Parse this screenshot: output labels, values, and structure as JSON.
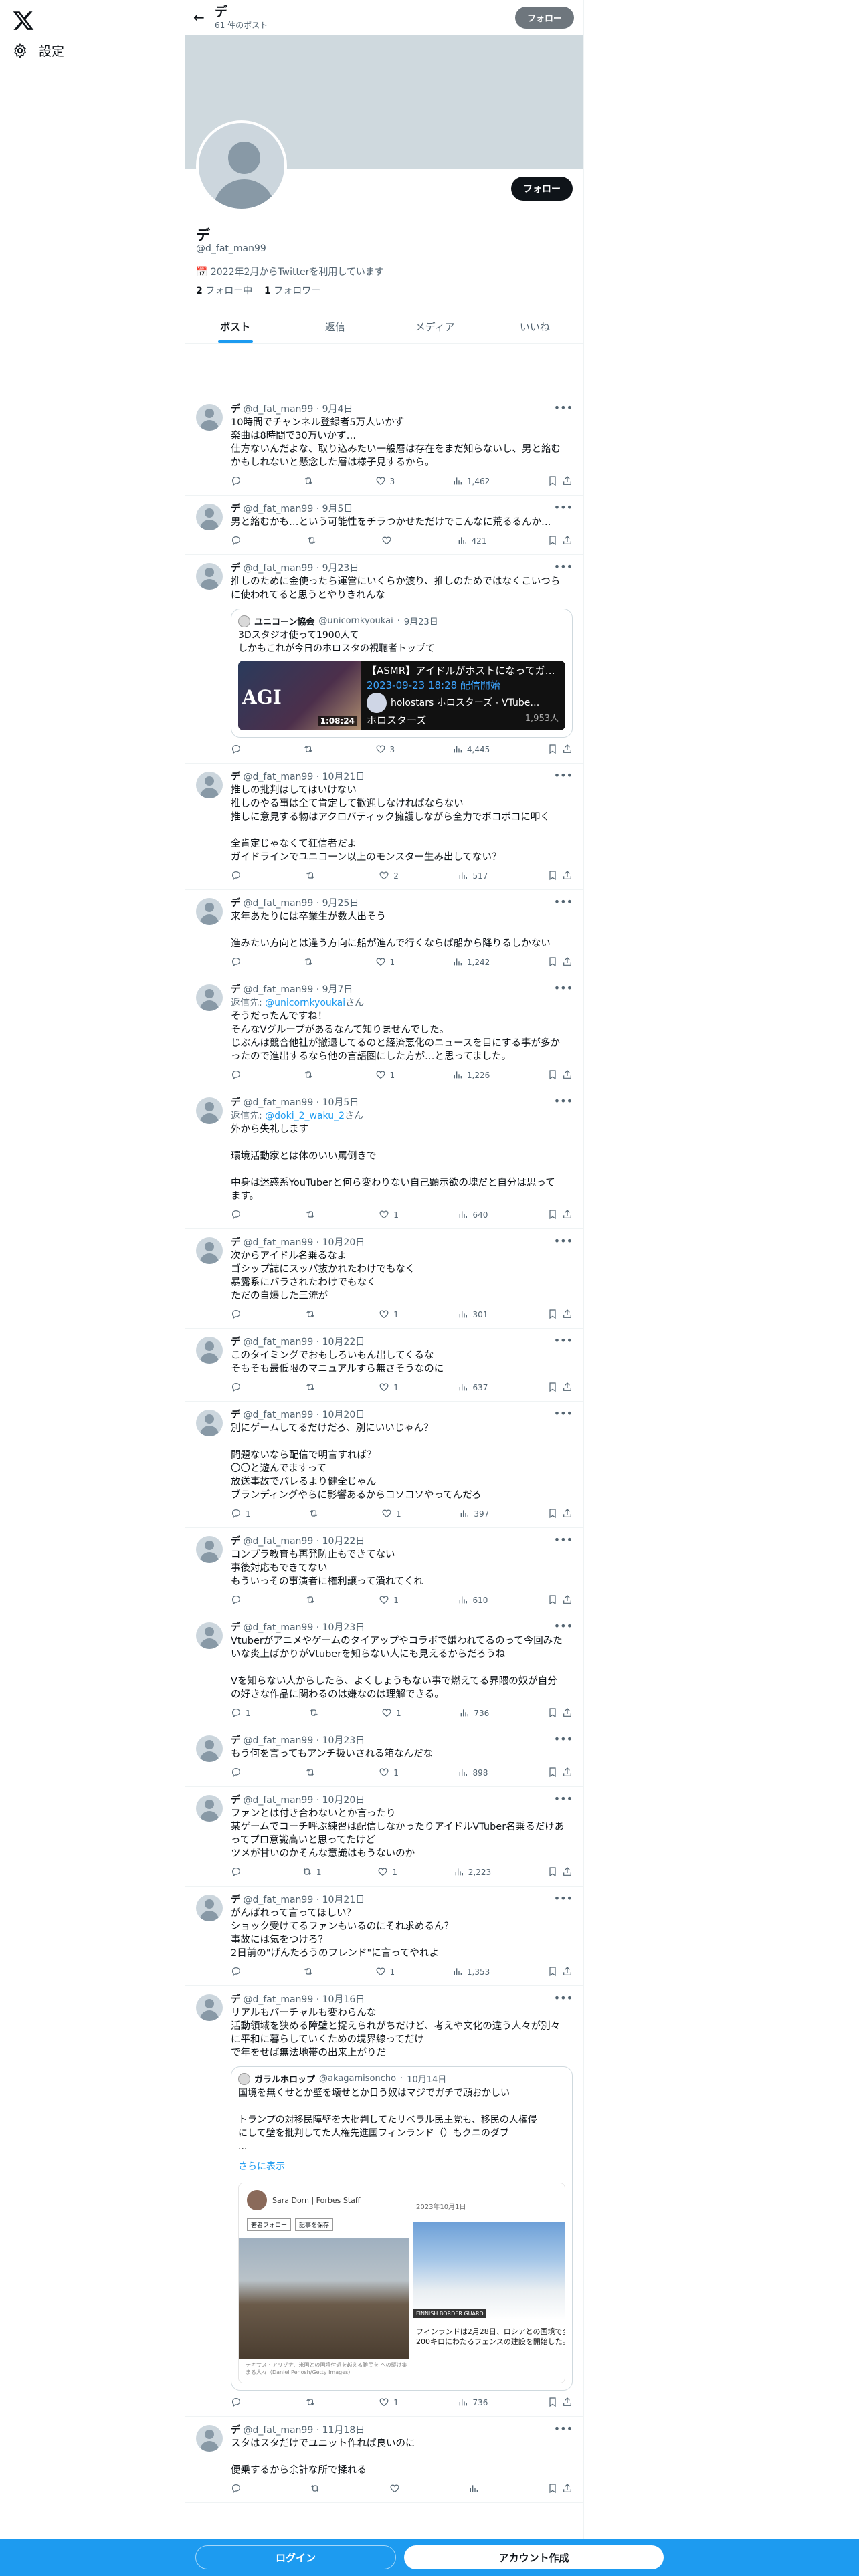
{
  "sidebar": {
    "settings_label": "設定"
  },
  "header": {
    "name": "デ",
    "post_count": "61 件のポスト",
    "follow_label": "フォロー"
  },
  "profile": {
    "name": "デ",
    "handle": "@d_fat_man99",
    "joined": "2022年2月からTwitterを利用しています",
    "following_count": "2",
    "following_label": "フォロー中",
    "followers_count": "1",
    "followers_label": "フォロワー",
    "follow_label": "フォロー"
  },
  "tabs": [
    "ポスト",
    "返信",
    "メディア",
    "いいね"
  ],
  "tweets": [
    {
      "name": "デ",
      "handle": "@d_fat_man99",
      "date": "9月4日",
      "text": "10時間でチャンネル登録者5万人いかず\n楽曲は8時間で30万いかず…\n仕方ないんだよな、取り込みたい一般層は存在をまだ知らないし、男と絡む\nかもしれないと懸念した層は様子見するから。",
      "replies": "",
      "retweets": "",
      "likes": "3",
      "views": "1,462"
    },
    {
      "name": "デ",
      "handle": "@d_fat_man99",
      "date": "9月5日",
      "text": "男と絡むかも…という可能性をチラつかせただけでこんなに荒るるんか…",
      "replies": "",
      "retweets": "",
      "likes": "",
      "views": "421"
    },
    {
      "name": "デ",
      "handle": "@d_fat_man99",
      "date": "9月23日",
      "text": "推しのために金使ったら運営にいくらか渡り、推しのためではなくこいつら\nに使われてると思うとやりきれんな",
      "replies": "",
      "retweets": "",
      "likes": "3",
      "views": "4,445"
    },
    {
      "name": "デ",
      "handle": "@d_fat_man99",
      "date": "10月21日",
      "text": "推しの批判はしてはいけない\n推しのやる事は全て肯定して歓迎しなければならない\n推しに意見する物はアクロバティック擁護しながら全力でボコボコに叩く\n\n全肯定じゃなくて狂信者だよ\nガイドラインでユニコーン以上のモンスター生み出してない？",
      "replies": "",
      "retweets": "",
      "likes": "2",
      "views": "517"
    },
    {
      "name": "デ",
      "handle": "@d_fat_man99",
      "date": "9月25日",
      "text": "来年あたりには卒業生が数人出そう\n\n進みたい方向とは違う方向に船が進んで行くならば船から降りるしかない",
      "replies": "",
      "retweets": "",
      "likes": "1",
      "views": "1,242"
    },
    {
      "name": "デ",
      "handle": "@d_fat_man99",
      "date": "9月7日",
      "reply_prefix": "返信先: ",
      "reply_to": "@unicornkyoukai",
      "reply_suffix": "さん",
      "text": "そうだったんですね！\nそんなVグループがあるなんて知りませんでした。\nじぶんは競合他社が撤退してるのと経済悪化のニュースを目にする事が多か\nったので進出するなら他の言語圏にした方が…と思ってました。",
      "replies": "",
      "retweets": "",
      "likes": "1",
      "views": "1,226"
    },
    {
      "name": "デ",
      "handle": "@d_fat_man99",
      "date": "10月5日",
      "reply_prefix": "返信先: ",
      "reply_to": "@doki_2_waku_2",
      "reply_suffix": "さん",
      "text": "外から失礼します\n\n環境活動家とは体のいい罵倒きで\n\n中身は迷惑系YouTuberと何ら変わりない自己顕示欲の塊だと自分は思って\nます。",
      "replies": "",
      "retweets": "",
      "likes": "1",
      "views": "640"
    },
    {
      "name": "デ",
      "handle": "@d_fat_man99",
      "date": "10月20日",
      "text": "次からアイドル名乗るなよ\nゴシップ誌にスッパ抜かれたわけでもなく\n暴露系にバラされたわけでもなく\nただの自爆した三流が",
      "replies": "",
      "retweets": "",
      "likes": "1",
      "views": "301"
    },
    {
      "name": "デ",
      "handle": "@d_fat_man99",
      "date": "10月22日",
      "text": "このタイミングでおもしろいもん出してくるな\nそもそも最低限のマニュアルすら無さそうなのに",
      "replies": "",
      "retweets": "",
      "likes": "1",
      "views": "637"
    },
    {
      "name": "デ",
      "handle": "@d_fat_man99",
      "date": "10月20日",
      "text": "別にゲームしてるだけだろ、別にいいじゃん？\n\n問題ないなら配信で明言すれば？\n〇〇と遊んでますって\n放送事故でバレるより健全じゃん\nブランディングやらに影響あるからコソコソやってんだろ",
      "replies": "1",
      "retweets": "",
      "likes": "1",
      "views": "397"
    },
    {
      "name": "デ",
      "handle": "@d_fat_man99",
      "date": "10月22日",
      "text": "コンプラ教育も再発防止もできてない\n事後対応もできてない\nもういっその事演者に権利譲って潰れてくれ",
      "replies": "",
      "retweets": "",
      "likes": "1",
      "views": "610"
    },
    {
      "name": "デ",
      "handle": "@d_fat_man99",
      "date": "10月23日",
      "text": "Vtuberがアニメやゲームのタイアップやコラボで嫌われてるのって今回みた\nいな炎上ばかりがVtuberを知らない人にも見えるからだろうね\n\nVを知らない人からしたら、よくしょうもない事で燃えてる界隈の奴が自分\nの好きな作品に関わるのは嫌なのは理解できる。",
      "replies": "1",
      "retweets": "",
      "likes": "1",
      "views": "736"
    },
    {
      "name": "デ",
      "handle": "@d_fat_man99",
      "date": "10月23日",
      "text": "もう何を言ってもアンチ扱いされる箱なんだな",
      "replies": "",
      "retweets": "",
      "likes": "1",
      "views": "898"
    },
    {
      "name": "デ",
      "handle": "@d_fat_man99",
      "date": "10月20日",
      "text": "ファンとは付き合わないとか言ったり\n某ゲームでコーチ呼ぶ練習は配信しなかったりアイドルVTuber名乗るだけあ\nってプロ意識高いと思ってたけど\nツメが甘いのかそんな意識はもうないのか",
      "replies": "",
      "retweets": "1",
      "likes": "1",
      "views": "2,223"
    },
    {
      "name": "デ",
      "handle": "@d_fat_man99",
      "date": "10月21日",
      "text": "がんばれって言ってほしい？\nショック受けてるファンもいるのにそれ求めるん？\n事故には気をつけろ？\n2日前の\"げんたろうのフレンド\"に言ってやれよ",
      "replies": "",
      "retweets": "",
      "likes": "1",
      "views": "1,353"
    },
    {
      "name": "デ",
      "handle": "@d_fat_man99",
      "date": "10月16日",
      "text": "リアルもバーチャルも変わらんな\n活動領域を狭める障壁と捉えられがちだけど、考えや文化の違う人々が別々\nに平和に暮らしていくための境界線ってだけ\nで年をせば無法地帯の出来上がりだ",
      "replies": "",
      "retweets": "",
      "likes": "1",
      "views": "736"
    },
    {
      "name": "デ",
      "handle": "@d_fat_man99",
      "date": "11月18日",
      "text": "スタはスタだけでユニット作れば良いのに\n\n便乗するから余計な所で揉れる",
      "replies": "",
      "retweets": "",
      "likes": "",
      "views": ""
    }
  ],
  "quote1": {
    "name": "ユニコーン協会",
    "handle": "@unicornkyoukai",
    "date": "9月23日",
    "text": "3Dスタジオ使って1900人て\nしかもこれが今日のホロスタの視聴者トップて",
    "card_title": "【ASMR】アイドルがホストになってガ…",
    "card_live": "2023-09-23 18:28 配信開始",
    "card_channel": "holostars ホロスターズ - VTube…",
    "card_channel2": "ホロスターズ",
    "card_views": "1,953人",
    "card_duration": "1:08:24",
    "card_thumb_text": "AGI"
  },
  "quote2": {
    "name": "ガラルホロップ",
    "handle": "@akagamisoncho",
    "date": "10月14日",
    "text": "国境を無くせとか壁を壊せとか日う奴はマジでガチで頭おかしい\n\nトランプの対移民障壁を大批判してたリベラル民主党も、移民の人権侵\nにして壁を批判してた人権先進国フィンランド（）もクニのダブ\n...",
    "more": "さらに表示",
    "author": "Sara Dorn | Forbes Staff",
    "pill1": "著者フォロー",
    "pill2": "記事を保存",
    "caption": "テキサス・アリゾナ、米国との国境付近を越える難民を\nへの駆け集まる人々（Daniel Penosh/Getty Images）",
    "date_right": "2023年10月1日",
    "tag": "FINNISH BORDER GUARD",
    "right_caption": "フィンランドは2月28日、ロシアとの国境で全長\n200キロにわたるフェンスの建設を開始した。全"
  },
  "bottom": {
    "login": "ログイン",
    "signup": "アカウント作成"
  },
  "colors": {
    "accent": "#1d9bf0",
    "text": "#0f1419",
    "muted": "#536471"
  }
}
